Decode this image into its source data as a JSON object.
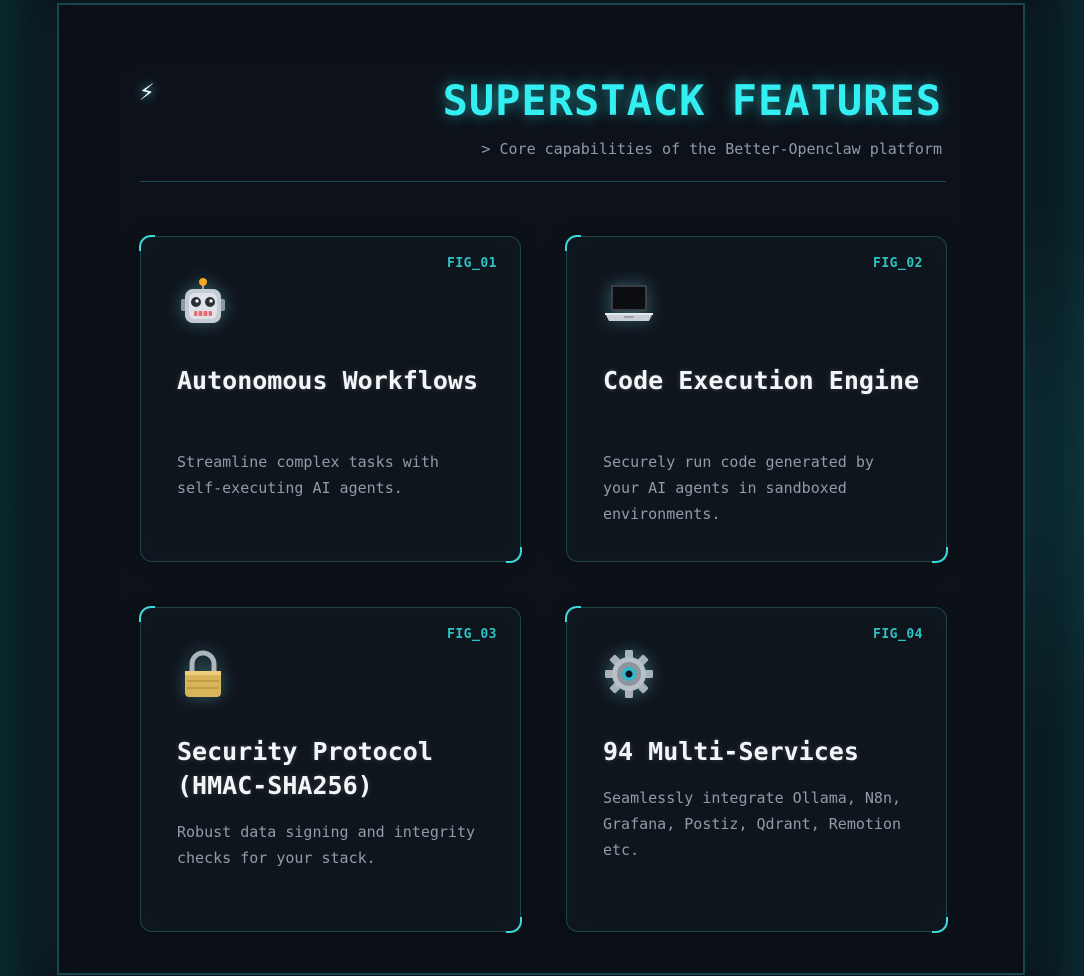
{
  "header": {
    "title": "SUPERSTACK FEATURES",
    "subtitle": "> Core capabilities of the Better-Openclaw platform",
    "logo_glyph": "⚡",
    "logo_icon": "lightning-bolt-icon"
  },
  "colors": {
    "accent": "#33eff2",
    "fig_label": "#2cc3c4",
    "border": "#1d4649",
    "corner": "#3ed8dd",
    "text_primary": "#f3f6f8",
    "text_secondary": "#8f9ba7",
    "background": "#0d121a"
  },
  "features": [
    {
      "fig": "FIG_01",
      "icon": "robot-icon",
      "title": "Autonomous Workflows",
      "description": "Streamline complex tasks with self-executing AI agents."
    },
    {
      "fig": "FIG_02",
      "icon": "laptop-icon",
      "title": "Code Execution Engine",
      "description": "Securely run code generated by your AI agents in sandboxed environments."
    },
    {
      "fig": "FIG_03",
      "icon": "lock-icon",
      "title": "Security Protocol (HMAC-SHA256)",
      "description": "Robust data signing and integrity checks for your stack."
    },
    {
      "fig": "FIG_04",
      "icon": "gear-icon",
      "title": "94 Multi-Services",
      "description": "Seamlessly integrate Ollama, N8n, Grafana, Postiz, Qdrant, Remotion etc."
    }
  ]
}
